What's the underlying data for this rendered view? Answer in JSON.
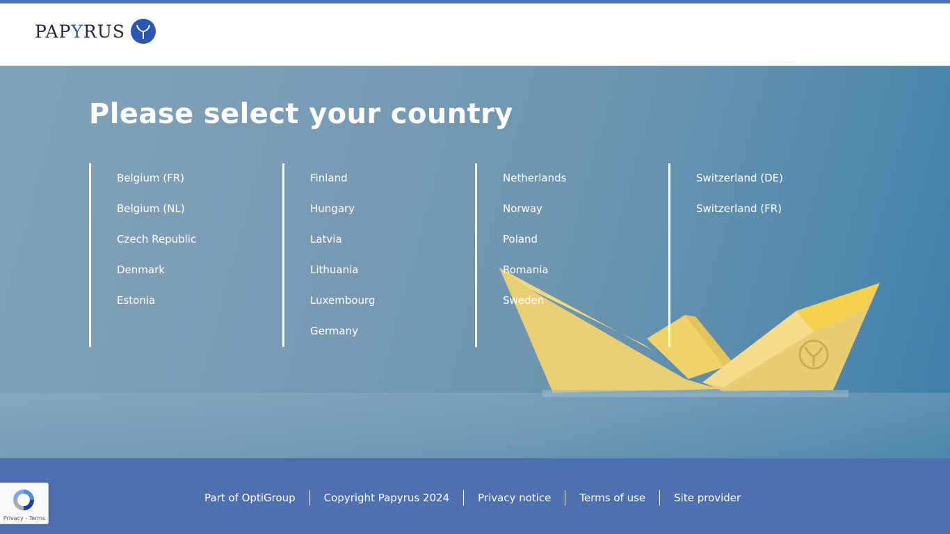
{
  "brand": {
    "logo_prefix": "PAP",
    "logo_y": "Y",
    "logo_suffix": "RUS",
    "logo_icon": "papyrus-y-logo-icon"
  },
  "colors": {
    "brand_blue": "#2a56b4",
    "footer_bg": "#4e6fb0",
    "hero_text": "#ffffff"
  },
  "hero": {
    "title": "Please select your country",
    "columns": [
      [
        "Belgium (FR)",
        "Belgium (NL)",
        "Czech Republic",
        "Denmark",
        "Estonia"
      ],
      [
        "Finland",
        "Hungary",
        "Latvia",
        "Lithuania",
        "Luxembourg",
        "Germany"
      ],
      [
        "Netherlands",
        "Norway",
        "Poland",
        "Romania",
        "Sweden"
      ],
      [
        "Switzerland (DE)",
        "Switzerland (FR)"
      ]
    ]
  },
  "footer": {
    "links": [
      "Part of OptiGroup",
      "Copyright Papyrus 2024",
      "Privacy notice",
      "Terms of use",
      "Site provider"
    ]
  },
  "recaptcha": {
    "icon": "recaptcha-icon",
    "links": "Privacy - Terms"
  }
}
